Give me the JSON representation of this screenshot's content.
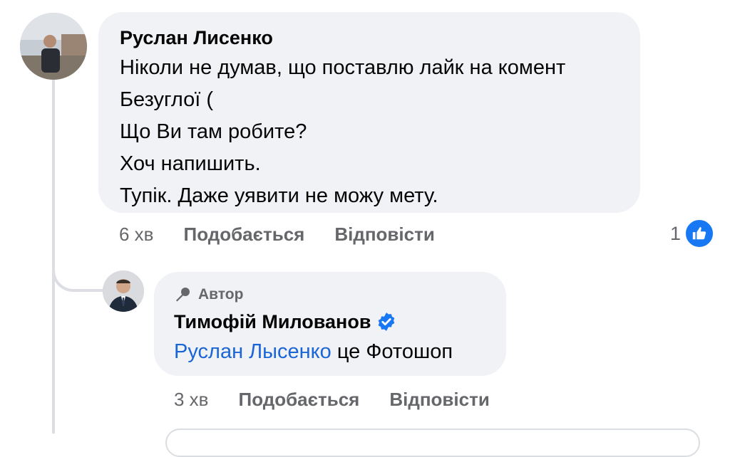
{
  "comments": [
    {
      "author": "Руслан Лисенко",
      "lines": [
        "Ніколи не думав, що поставлю лайк на комент",
        "Безуглої (",
        "Що Ви там робите?",
        "Хоч напишить.",
        "Тупік. Даже уявити не можу мету."
      ],
      "time": "6 хв",
      "like_label": "Подобається",
      "reply_label": "Відповісти",
      "reaction_count": "1"
    }
  ],
  "reply": {
    "badge": "Автор",
    "author": "Тимофій Милованов",
    "verified_icon": "verified-check-icon",
    "mention": "Руслан Лысенко",
    "text": " це Фотошоп",
    "time": "3 хв",
    "like_label": "Подобається",
    "reply_label": "Відповісти"
  },
  "colors": {
    "bubble": "#f0f2f5",
    "meta_text": "#65676b",
    "link": "#1b66d6",
    "like_blue": "#1877f2"
  }
}
